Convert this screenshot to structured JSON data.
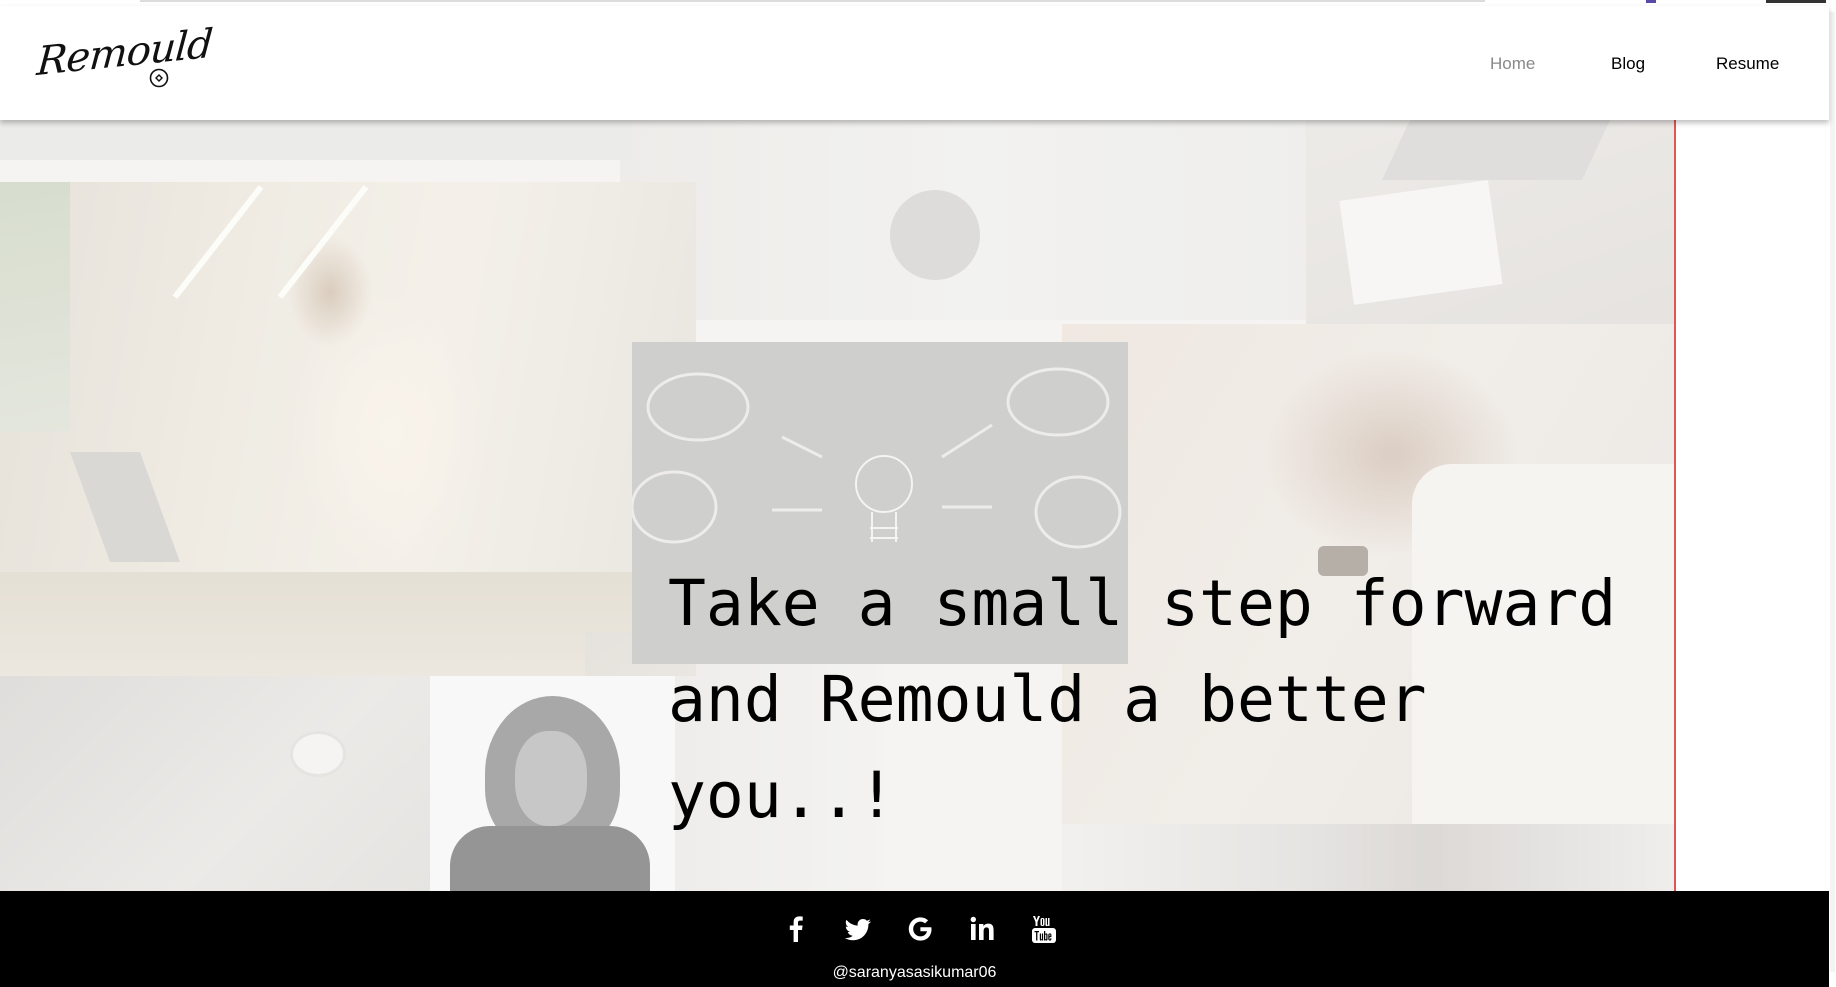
{
  "brand": {
    "logo_text": "Remould"
  },
  "nav": {
    "items": [
      {
        "label": "Home",
        "active": true
      },
      {
        "label": "Blog",
        "active": false
      },
      {
        "label": "Resume",
        "active": false
      }
    ]
  },
  "hero": {
    "headline": "Take a small step forward and Remould a better you..!"
  },
  "footer": {
    "social": [
      {
        "icon": "facebook-icon"
      },
      {
        "icon": "twitter-icon"
      },
      {
        "icon": "google-icon"
      },
      {
        "icon": "linkedin-icon"
      },
      {
        "icon": "youtube-icon"
      }
    ],
    "handle": "@saranyasasikumar06"
  },
  "colors": {
    "nav_active": "#888888",
    "footer_bg": "#000000",
    "hero_border": "#e05555"
  }
}
